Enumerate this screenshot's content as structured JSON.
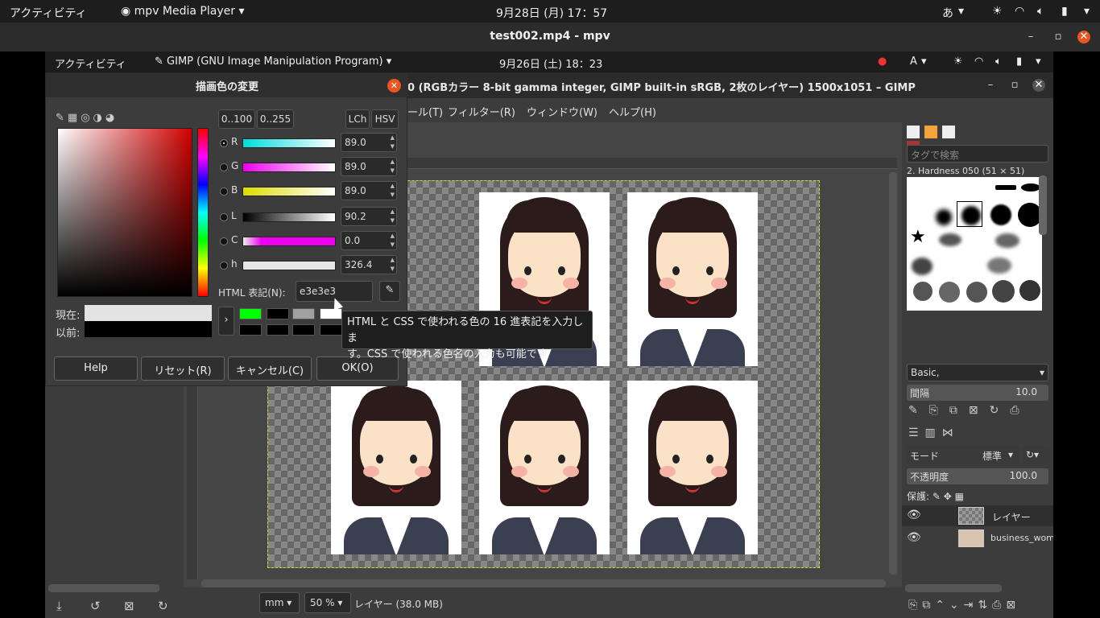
{
  "outer_topbar": {
    "activities": "アクティビティ",
    "app": "mpv Media Player",
    "clock": "9月28日 (月)  17：57",
    "ime": "あ"
  },
  "mpv": {
    "title": "test002.mp4 - mpv"
  },
  "inner_topbar": {
    "activities": "アクティビティ",
    "app": "GIMP (GNU Image Manipulation Program)",
    "clock": "9月26日 (土)  18：23",
    "ime": "A"
  },
  "gimp": {
    "title_fragment": "0 (RGBカラー 8-bit gamma integer, GIMP built-in sRGB, 2枚のレイヤー) 1500x1051 – GIMP",
    "menus": [
      "ール(T)",
      "フィルター(R)",
      "ウィンドウ(W)",
      "ヘルプ(H)"
    ],
    "status": {
      "unit": "mm",
      "zoom": "50 %",
      "layer_info": "レイヤー (38.0 MB)"
    }
  },
  "dock": {
    "tag_placeholder": "タグで検索",
    "brush_name": "2. Hardness 050 (51 × 51)",
    "preset": "Basic,",
    "spacing_label": "間隔",
    "spacing_value": "10.0",
    "mode_label": "モード",
    "mode_value": "標準",
    "opacity_label": "不透明度",
    "opacity_value": "100.0",
    "lock_label": "保護:",
    "layers": [
      {
        "name": "レイヤー"
      },
      {
        "name": "business_wom"
      }
    ]
  },
  "color_dialog": {
    "title": "描画色の変更",
    "range_buttons": [
      "0..100",
      "0..255"
    ],
    "model_buttons": [
      "LCh",
      "HSV"
    ],
    "sliders": [
      {
        "label": "R",
        "value": "89.0",
        "selected": true
      },
      {
        "label": "G",
        "value": "89.0",
        "selected": false
      },
      {
        "label": "B",
        "value": "89.0",
        "selected": false
      },
      {
        "label": "L",
        "value": "90.2",
        "selected": false
      },
      {
        "label": "C",
        "value": "0.0",
        "selected": false
      },
      {
        "label": "h",
        "value": "326.4",
        "selected": false
      }
    ],
    "html_label": "HTML 表記(N):",
    "html_value": "e3e3e3",
    "current_label": "現在:",
    "previous_label": "以前:",
    "current_color": "#e3e3e3",
    "previous_color": "#000000",
    "history_colors": [
      "#00ff00",
      "#000000",
      "#a0a0a0",
      "#ffffff",
      "#000000",
      "#000000",
      "#000000",
      "#000000",
      "#000000",
      "#000000"
    ],
    "buttons": {
      "help": "Help",
      "reset": "リセット(R)",
      "cancel": "キャンセル(C)",
      "ok": "OK(O)"
    }
  },
  "tooltip": {
    "line1": "HTML と CSS で使われる色の 16 進表記を入力しま",
    "line2": "す。CSS で使われる色名の入力も可能です"
  }
}
